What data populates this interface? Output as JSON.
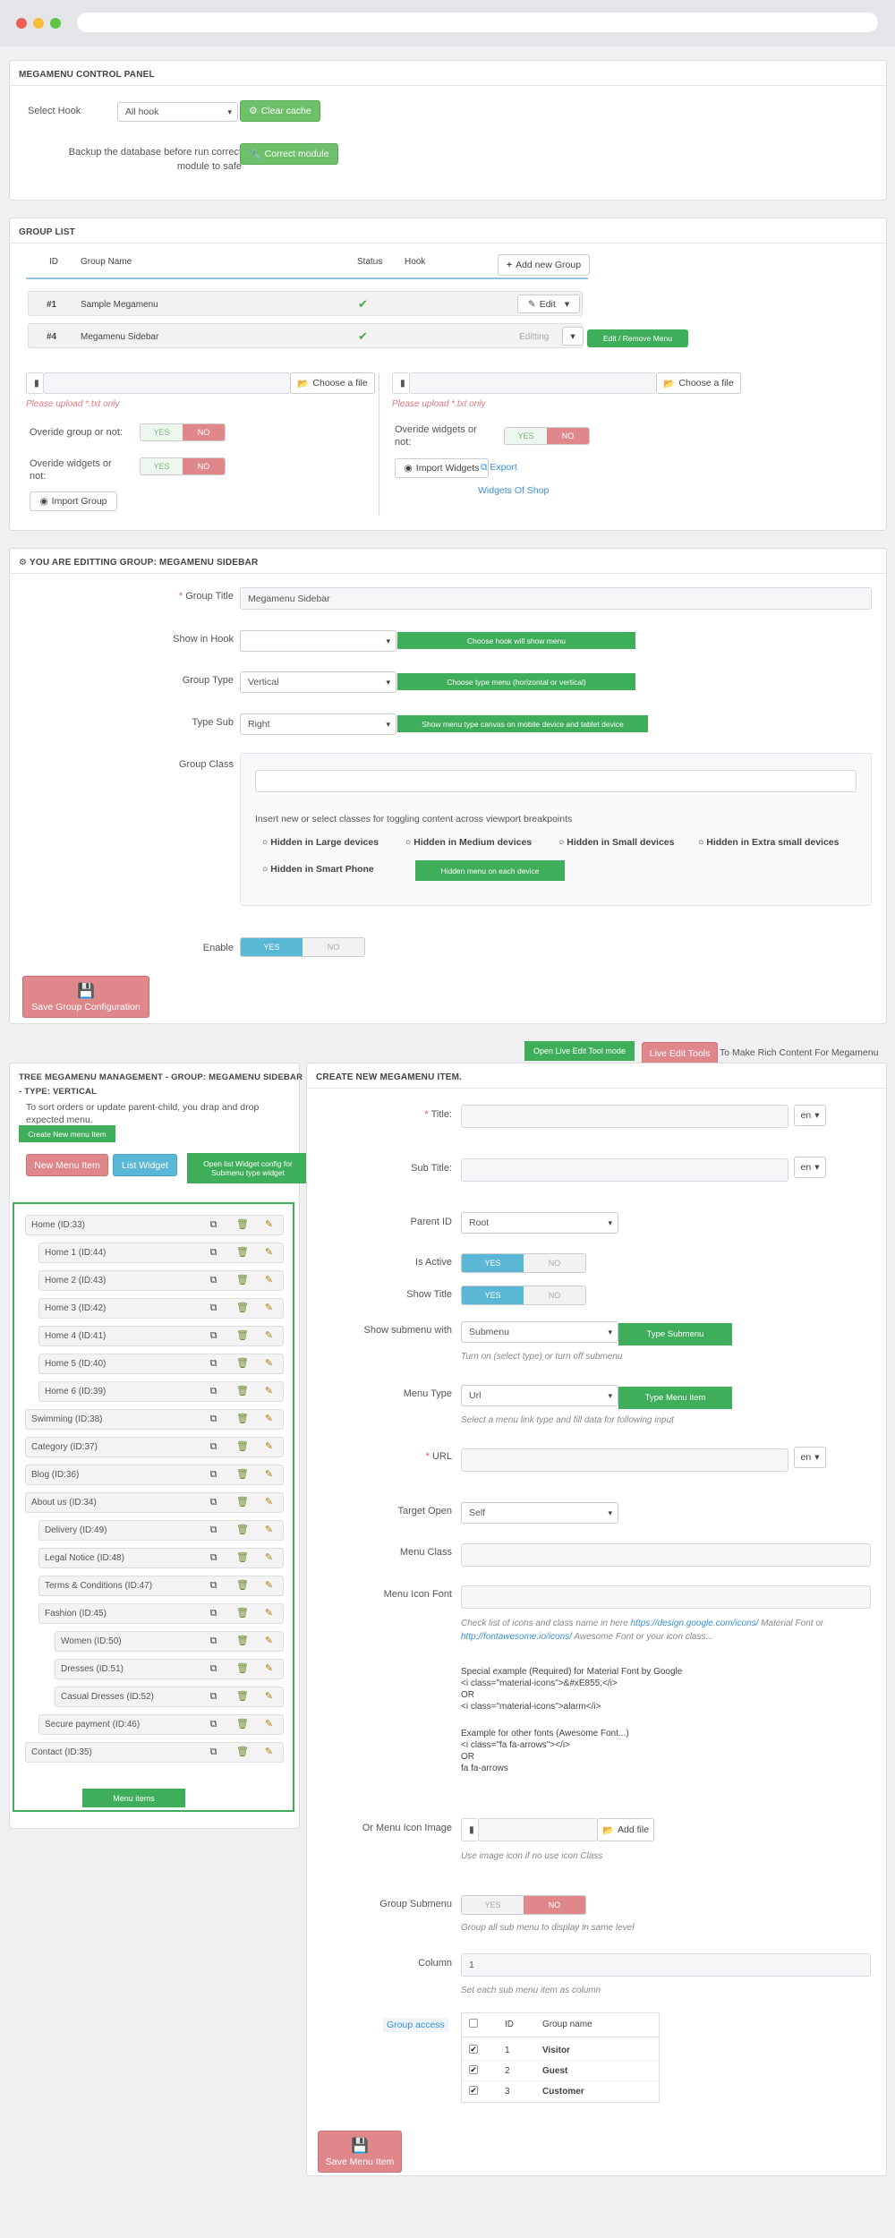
{
  "control_panel": {
    "title": "MEGAMENU CONTROL PANEL",
    "select_hook_label": "Select Hook",
    "select_hook_value": "All hook",
    "clear_cache_label": "Clear cache",
    "backup_line1": "Backup the database before run correct",
    "backup_line2": "module to safe",
    "correct_module_label": "Correct module"
  },
  "group_list": {
    "title": "GROUP LIST",
    "columns": [
      "ID",
      "Group Name",
      "Status",
      "Hook"
    ],
    "add_group_label": "Add new Group",
    "rows": [
      {
        "id": "#1",
        "name": "Sample Megamenu",
        "action": "Edit"
      },
      {
        "id": "#4",
        "name": "Megamenu Sidebar",
        "action": "Editting"
      }
    ],
    "edit_remove_tag": "Edit / Remove Menu",
    "choose_file_label": "Choose a file",
    "upload_hint": "Please upload *.txt only",
    "override_group_label": "Overide group or not:",
    "override_widgets_label1": "Overide widgets or",
    "override_widgets_label2": "not:",
    "yes": "YES",
    "no": "NO",
    "import_group_label": "Import Group",
    "import_widgets_label": "Import Widgets",
    "export_label": "Export",
    "widgets_of_shop": "Widgets Of Shop"
  },
  "edit_group": {
    "title": "YOU ARE EDITTING GROUP: MEGAMENU SIDEBAR",
    "group_title_label": "Group Title",
    "group_title_value": "Megamenu Sidebar",
    "show_in_hook_label": "Show in Hook",
    "show_in_hook_tag": "Choose hook will show menu",
    "group_type_label": "Group Type",
    "group_type_value": "Vertical",
    "group_type_tag": "Choose type menu (horizontal or vertical)",
    "type_sub_label": "Type Sub",
    "type_sub_value": "Right",
    "type_sub_tag": "Show menu type canvas on mobile device and tablet device",
    "group_class_label": "Group Class",
    "class_hint": "Insert new or select classes for toggling content across viewport breakpoints",
    "hidden_options": [
      "Hidden in Large devices",
      "Hidden in Medium devices",
      "Hidden in Small devices",
      "Hidden in Extra small devices",
      "Hidden in Smart Phone"
    ],
    "hidden_tag": "Hidden menu on each device",
    "enable_label": "Enable",
    "yes": "YES",
    "no": "NO",
    "save_label": "Save Group Configuration"
  },
  "live_edit": {
    "open_live_tag": "Open Live Edit Tool mode",
    "live_tools_label": "Live Edit Tools",
    "live_hint": "To Make Rich Content For Megamenu"
  },
  "tree": {
    "title": "TREE MEGAMENU MANAGEMENT - GROUP: MEGAMENU SIDEBAR - TYPE: VERTICAL",
    "hint_line1": "To sort orders or update parent-child, you drap and drop",
    "hint_line2": "expected menu.",
    "create_tag": "Create New menu Item",
    "new_menu_item": "New Menu Item",
    "list_widget": "List Widget",
    "widget_tag": "Open list Widget config for Submenu type widget",
    "menu_items_tag": "Menu items",
    "items": [
      {
        "label": "Home (ID:33)",
        "level": 0
      },
      {
        "label": "Home 1 (ID:44)",
        "level": 1
      },
      {
        "label": "Home 2 (ID:43)",
        "level": 1
      },
      {
        "label": "Home 3 (ID:42)",
        "level": 1
      },
      {
        "label": "Home 4 (ID:41)",
        "level": 1
      },
      {
        "label": "Home 5 (ID:40)",
        "level": 1
      },
      {
        "label": "Home 6 (ID:39)",
        "level": 1
      },
      {
        "label": "Swimming (ID:38)",
        "level": 0
      },
      {
        "label": "Category (ID:37)",
        "level": 0
      },
      {
        "label": "Blog (ID:36)",
        "level": 0
      },
      {
        "label": "About us (ID:34)",
        "level": 0
      },
      {
        "label": "Delivery (ID:49)",
        "level": 1
      },
      {
        "label": "Legal Notice (ID:48)",
        "level": 1
      },
      {
        "label": "Terms & Conditions (ID:47)",
        "level": 1
      },
      {
        "label": "Fashion (ID:45)",
        "level": 1
      },
      {
        "label": "Women (ID:50)",
        "level": 2
      },
      {
        "label": "Dresses (ID:51)",
        "level": 2
      },
      {
        "label": "Casual Dresses (ID:52)",
        "level": 2
      },
      {
        "label": "Secure payment (ID:46)",
        "level": 1
      },
      {
        "label": "Contact (ID:35)",
        "level": 0
      }
    ]
  },
  "create_item": {
    "title": "CREATE NEW MEGAMENU ITEM.",
    "title_label": "Title:",
    "sub_title_label": "Sub Title:",
    "lang": "en",
    "parent_id_label": "Parent ID",
    "parent_id_value": "Root",
    "is_active_label": "Is Active",
    "show_title_label": "Show Title",
    "yes": "YES",
    "no": "NO",
    "show_submenu_label": "Show submenu with",
    "show_submenu_value": "Submenu",
    "type_submenu_tag": "Type Submenu",
    "submenu_hint": "Turn on (select type) or turn off submenu",
    "menu_type_label": "Menu Type",
    "menu_type_value": "Url",
    "type_menu_tag": "Type Menu item",
    "menu_type_hint": "Select a menu link type and fill data for following input",
    "url_label": "URL",
    "target_open_label": "Target Open",
    "target_open_value": "Self",
    "menu_class_label": "Menu Class",
    "menu_icon_font_label": "Menu Icon Font",
    "icon_hint_pre": "Check list of icons and class name in here",
    "icon_hint_link1": "https://design.google.com/icons/",
    "icon_hint_mid": "Material Font or",
    "icon_hint_link2": "http://fontawesome.io/icons/",
    "icon_hint_post": "Awesome Font or your icon class...",
    "special_line1": "Special example (Required) for Material Font by Google",
    "special_line2": "<i class=\"material-icons\">&#xE855;</i>",
    "special_line3": "OR",
    "special_line4": "<i class=\"material-icons\">alarm</i>",
    "other_line1": "Example for other fonts (Awesome Font...)",
    "other_line2": "<i class=\"fa fa-arrows\"></i>",
    "other_line3": "OR",
    "other_line4": "fa fa-arrows",
    "icon_image_label": "Or Menu Icon Image",
    "add_file_label": "Add file",
    "icon_image_hint": "Use image icon if no use icon Class",
    "group_submenu_label": "Group Submenu",
    "group_submenu_hint": "Group all sub menu to display in same level",
    "column_label": "Column",
    "column_value": "1",
    "column_hint": "Set each sub menu item as column",
    "group_access_label": "Group access",
    "access_columns": [
      "ID",
      "Group name"
    ],
    "access_rows": [
      {
        "id": "1",
        "name": "Visitor"
      },
      {
        "id": "2",
        "name": "Guest"
      },
      {
        "id": "3",
        "name": "Customer"
      }
    ],
    "save_label": "Save Menu Item"
  }
}
